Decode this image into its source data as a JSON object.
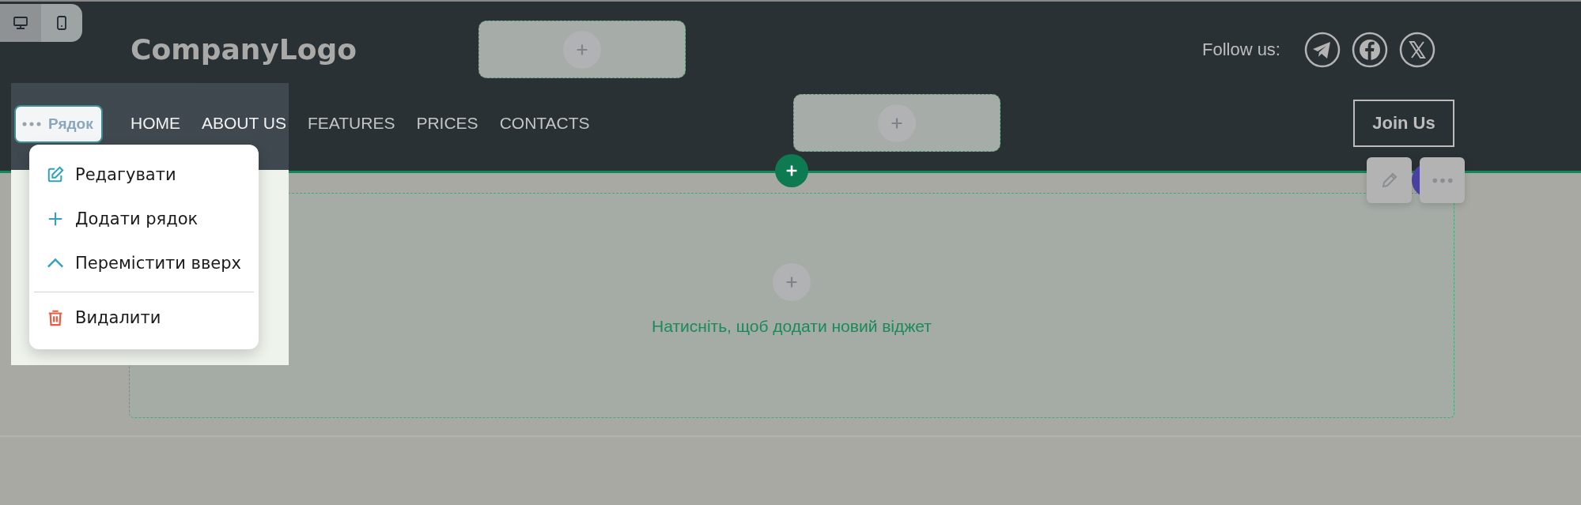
{
  "device_toggle": [
    {
      "kind": "desktop",
      "selected": true
    },
    {
      "kind": "mobile",
      "selected": false
    }
  ],
  "header": {
    "logo": "CompanyLogo",
    "follow_label": "Follow us:",
    "social": [
      {
        "kind": "telegram"
      },
      {
        "kind": "facebook"
      },
      {
        "kind": "x"
      }
    ],
    "nav": [
      "HOME",
      "ABOUT US",
      "FEATURES",
      "PRICES",
      "CONTACTS"
    ],
    "join_button": "Join Us"
  },
  "row_button": {
    "label": "Рядок"
  },
  "row_menu": {
    "groups": [
      [
        {
          "kind": "edit",
          "label": "Редагувати"
        },
        {
          "kind": "add",
          "label": "Додати рядок"
        },
        {
          "kind": "move_up",
          "label": "Перемістити вверх"
        }
      ],
      [
        {
          "kind": "delete",
          "label": "Видалити"
        }
      ]
    ]
  },
  "content": {
    "hint": "Натисніть, щоб додати новий віджет"
  }
}
